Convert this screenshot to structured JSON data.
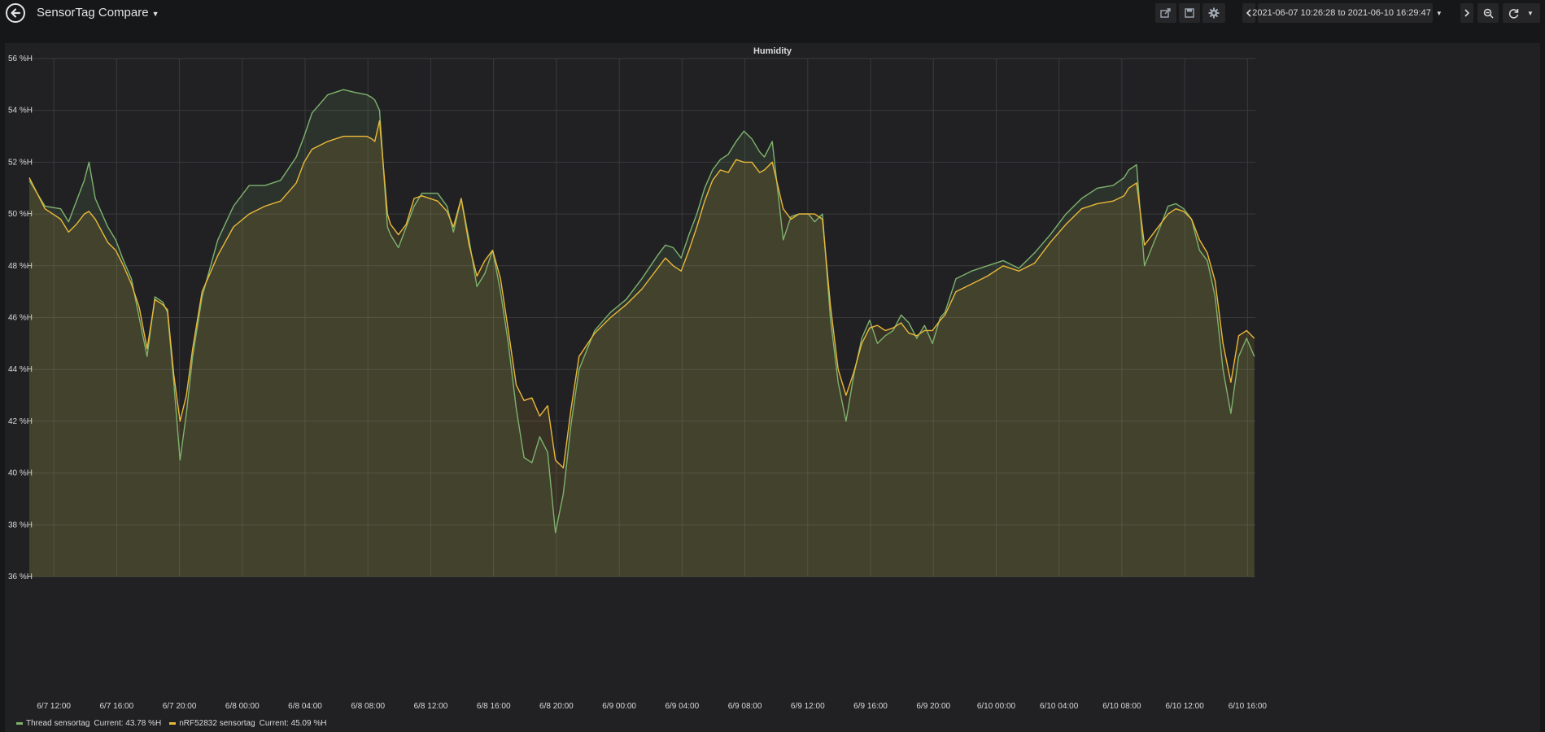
{
  "navbar": {
    "dashboard_title": "SensorTag Compare",
    "time_range": "2021-06-07 10:26:28 to 2021-06-10 16:29:47",
    "icons": [
      "back-arrow-icon",
      "share-icon",
      "save-icon",
      "gear-icon",
      "chevron-left-icon",
      "clock-icon",
      "chevron-right-icon",
      "zoom-out-icon",
      "refresh-icon",
      "caret-down-icon"
    ]
  },
  "panel": {
    "title": "Humidity"
  },
  "legend": [
    {
      "name": "Thread sensortag",
      "current": "Current: 43.78 %H",
      "color": "#7eb26d"
    },
    {
      "name": "nRF52832 sensortag",
      "current": "Current: 45.09 %H",
      "color": "#eab839"
    }
  ],
  "chart_data": {
    "type": "line",
    "title": "Humidity",
    "y_unit": "%H",
    "ylim": [
      36,
      56
    ],
    "y_ticks": [
      "56 %H",
      "54 %H",
      "52 %H",
      "50 %H",
      "48 %H",
      "46 %H",
      "44 %H",
      "42 %H",
      "40 %H",
      "38 %H",
      "36 %H"
    ],
    "x_ticks": [
      "6/7 12:00",
      "6/7 16:00",
      "6/7 20:00",
      "6/8 00:00",
      "6/8 04:00",
      "6/8 08:00",
      "6/8 12:00",
      "6/8 16:00",
      "6/8 20:00",
      "6/9 00:00",
      "6/9 04:00",
      "6/9 08:00",
      "6/9 12:00",
      "6/9 16:00",
      "6/9 20:00",
      "6/10 00:00",
      "6/10 04:00",
      "6/10 08:00",
      "6/10 12:00",
      "6/10 16:00"
    ],
    "x_tick_hours": [
      1.56,
      5.56,
      9.56,
      13.56,
      17.56,
      21.56,
      25.56,
      29.56,
      33.56,
      37.56,
      41.56,
      45.56,
      49.56,
      53.56,
      57.56,
      61.56,
      65.56,
      69.56,
      73.56,
      77.56
    ],
    "x_range_hours": [
      0,
      78.06
    ],
    "grid": true,
    "fill": true,
    "series": [
      {
        "name": "Thread sensortag",
        "color": "#7eb26d",
        "x_hours": [
          0,
          1,
          2,
          2.5,
          3,
          3.5,
          3.8,
          4.2,
          5,
          5.5,
          6,
          6.5,
          7,
          7.5,
          8,
          8.5,
          8.8,
          9.2,
          9.6,
          10,
          10.4,
          11,
          12,
          13,
          14,
          15,
          16,
          17,
          17.5,
          18,
          19,
          20,
          20.7,
          21.5,
          21.8,
          22,
          22.3,
          22.8,
          23,
          23.5,
          24,
          24.5,
          25,
          26,
          26.6,
          27,
          27.5,
          28,
          28.5,
          29,
          29.5,
          30,
          30.5,
          31,
          31.5,
          32,
          32.5,
          33,
          33.5,
          34,
          34.5,
          35,
          36,
          37,
          38,
          39,
          40,
          40.5,
          41,
          41.5,
          42,
          42.5,
          43,
          43.5,
          44,
          44.5,
          45,
          45.5,
          46,
          46.5,
          46.8,
          47.3,
          48,
          48.5,
          49,
          49.6,
          50,
          50.5,
          51,
          51.5,
          52,
          52.5,
          53,
          53.5,
          54,
          54.5,
          55,
          55.5,
          56,
          56.5,
          57,
          57.5,
          58,
          58.3,
          59,
          60,
          61,
          62,
          63,
          64,
          65,
          66,
          67,
          68,
          69,
          69.7,
          70,
          70.5,
          71,
          72,
          72.5,
          73,
          73.5,
          74,
          74.5,
          75,
          75.5,
          76,
          76.5,
          77,
          77.5,
          78
        ],
        "values": [
          51.3,
          50.3,
          50.2,
          49.7,
          50.5,
          51.3,
          52.0,
          50.6,
          49.5,
          49.0,
          48.2,
          47.5,
          46.0,
          44.5,
          46.8,
          46.6,
          46.2,
          43.5,
          40.5,
          42.3,
          44.5,
          46.8,
          49.0,
          50.3,
          51.1,
          51.1,
          51.3,
          52.2,
          53.0,
          53.9,
          54.6,
          54.8,
          54.7,
          54.6,
          54.5,
          54.4,
          54.0,
          49.5,
          49.2,
          48.7,
          49.5,
          50.3,
          50.8,
          50.8,
          50.3,
          49.3,
          50.6,
          49.0,
          47.2,
          47.7,
          48.6,
          47.0,
          45.0,
          42.5,
          40.6,
          40.4,
          41.4,
          40.8,
          37.7,
          39.2,
          41.9,
          44.0,
          45.5,
          46.2,
          46.7,
          47.5,
          48.4,
          48.8,
          48.7,
          48.3,
          49.2,
          50.0,
          51.0,
          51.7,
          52.1,
          52.3,
          52.8,
          53.2,
          52.9,
          52.4,
          52.2,
          52.8,
          49.0,
          49.9,
          50.0,
          50.0,
          49.7,
          50.0,
          46.0,
          43.5,
          42.0,
          43.8,
          45.2,
          45.9,
          45.0,
          45.3,
          45.5,
          46.1,
          45.8,
          45.2,
          45.7,
          45.0,
          46.0,
          46.2,
          47.5,
          47.8,
          48.0,
          48.2,
          47.9,
          48.5,
          49.2,
          50.0,
          50.6,
          51.0,
          51.1,
          51.4,
          51.7,
          51.9,
          48.0,
          49.5,
          50.3,
          50.4,
          50.2,
          49.8,
          48.6,
          48.2,
          46.8,
          44.0,
          42.3,
          44.5,
          45.2,
          44.5,
          44.0,
          44.3,
          43.8
        ]
      },
      {
        "name": "nRF52832 sensortag",
        "color": "#eab839",
        "x_hours": [
          0,
          1,
          2,
          2.5,
          3,
          3.5,
          3.8,
          4.2,
          5,
          5.5,
          6,
          6.5,
          7,
          7.5,
          8,
          8.5,
          8.8,
          9.2,
          9.6,
          10,
          10.4,
          11,
          12,
          13,
          14,
          15,
          16,
          17,
          17.5,
          18,
          19,
          20,
          20.7,
          21.5,
          21.8,
          22,
          22.3,
          22.8,
          23,
          23.5,
          24,
          24.5,
          25,
          26,
          26.6,
          27,
          27.5,
          28,
          28.5,
          29,
          29.5,
          30,
          30.5,
          31,
          31.5,
          32,
          32.5,
          33,
          33.5,
          34,
          34.5,
          35,
          36,
          37,
          38,
          39,
          40,
          40.5,
          41,
          41.5,
          42,
          42.5,
          43,
          43.5,
          44,
          44.5,
          45,
          45.5,
          46,
          46.5,
          46.8,
          47.3,
          48,
          48.5,
          49,
          49.6,
          50,
          50.5,
          51,
          51.5,
          52,
          52.5,
          53,
          53.5,
          54,
          54.5,
          55,
          55.5,
          56,
          56.5,
          57,
          57.5,
          58,
          58.3,
          59,
          60,
          61,
          62,
          63,
          64,
          65,
          66,
          67,
          68,
          69,
          69.7,
          70,
          70.5,
          71,
          72,
          72.5,
          73,
          73.5,
          74,
          74.5,
          75,
          75.5,
          76,
          76.5,
          77,
          77.5,
          78
        ],
        "values": [
          51.4,
          50.2,
          49.8,
          49.3,
          49.6,
          50.0,
          50.1,
          49.8,
          48.9,
          48.6,
          48.0,
          47.3,
          46.4,
          44.8,
          46.7,
          46.5,
          46.3,
          43.8,
          42.0,
          43.0,
          44.8,
          47.0,
          48.4,
          49.5,
          50.0,
          50.3,
          50.5,
          51.2,
          52.0,
          52.5,
          52.8,
          53.0,
          53.0,
          53.0,
          52.9,
          52.8,
          53.6,
          50.0,
          49.6,
          49.2,
          49.6,
          50.6,
          50.7,
          50.5,
          50.1,
          49.5,
          50.6,
          48.8,
          47.6,
          48.2,
          48.6,
          47.5,
          45.5,
          43.4,
          42.8,
          42.9,
          42.2,
          42.6,
          40.5,
          40.2,
          42.5,
          44.5,
          45.4,
          46.0,
          46.5,
          47.1,
          47.9,
          48.3,
          48.0,
          47.8,
          48.6,
          49.5,
          50.5,
          51.3,
          51.7,
          51.6,
          52.1,
          52.0,
          52.0,
          51.6,
          51.7,
          52.0,
          50.2,
          49.8,
          50.0,
          50.0,
          50.0,
          49.8,
          46.5,
          44.0,
          43.0,
          43.9,
          45.0,
          45.6,
          45.7,
          45.5,
          45.6,
          45.8,
          45.4,
          45.3,
          45.5,
          45.5,
          45.9,
          46.1,
          47.0,
          47.3,
          47.6,
          48.0,
          47.8,
          48.1,
          48.9,
          49.6,
          50.2,
          50.4,
          50.5,
          50.7,
          51.0,
          51.2,
          48.8,
          49.6,
          50.0,
          50.2,
          50.1,
          49.8,
          49.0,
          48.5,
          47.4,
          45.0,
          43.5,
          45.3,
          45.5,
          45.2,
          44.9,
          45.0,
          45.1
        ]
      }
    ]
  }
}
